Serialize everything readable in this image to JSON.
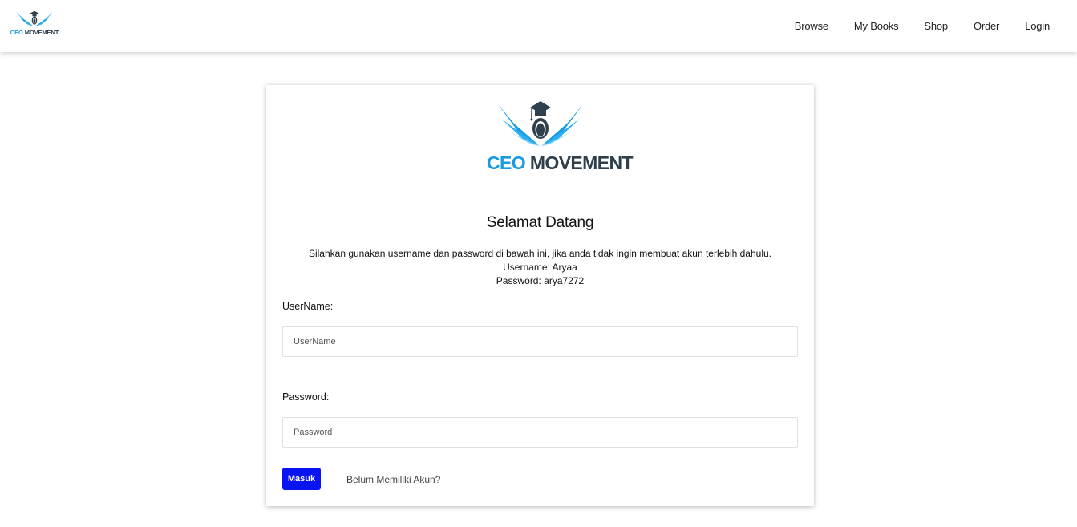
{
  "brand": {
    "name_part1": "CEO",
    "name_part2": "MOVEMENT",
    "colors": {
      "blue": "#1a9be0",
      "dark": "#2f3f4c"
    }
  },
  "nav": {
    "items": [
      {
        "label": "Browse"
      },
      {
        "label": "My Books"
      },
      {
        "label": "Shop"
      },
      {
        "label": "Order"
      },
      {
        "label": "Login"
      }
    ]
  },
  "login": {
    "title": "Selamat Datang",
    "info_line1": "Silahkan gunakan username dan password di bawah ini, jika anda tidak ingin membuat akun terlebih dahulu.",
    "info_line2": "Username: Aryaa",
    "info_line3": "Password: arya7272",
    "username_label": "UserName:",
    "username_placeholder": "UserName",
    "password_label": "Password:",
    "password_placeholder": "Password",
    "submit_label": "Masuk",
    "register_link": "Belum Memiliki Akun?",
    "submit_color": "#0a14f0"
  }
}
